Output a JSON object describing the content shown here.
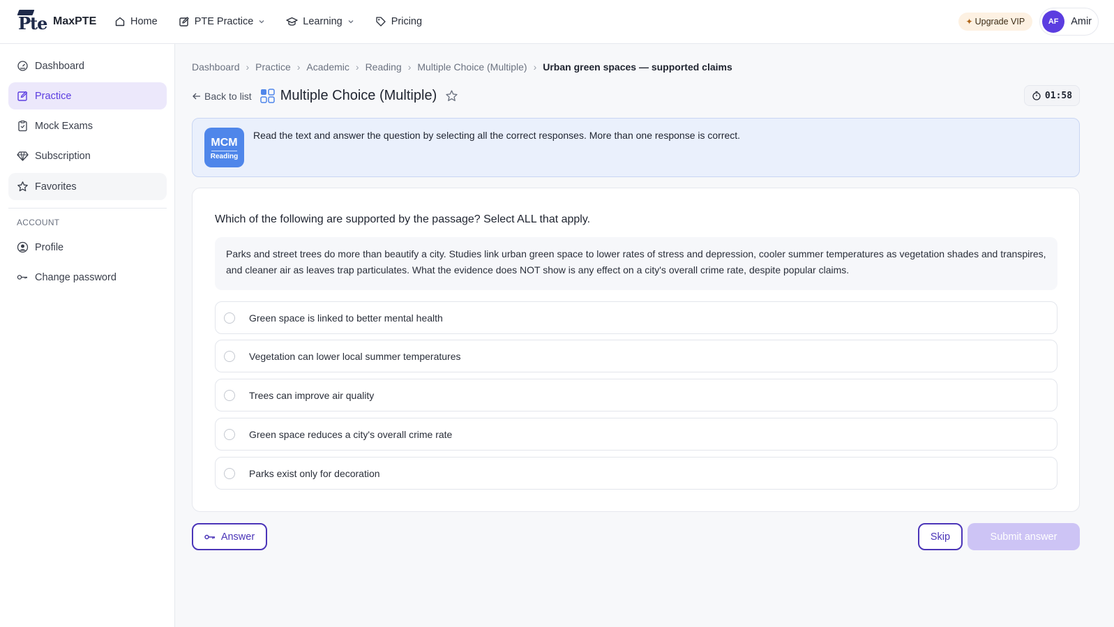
{
  "brand": {
    "logo_text": "Pte",
    "name": "MaxPTE"
  },
  "nav": {
    "home": "Home",
    "pte_practice": "PTE Practice",
    "learning": "Learning",
    "pricing": "Pricing"
  },
  "topbar": {
    "vip_label": "Upgrade VIP",
    "user_initials": "AF",
    "user_name": "Amir"
  },
  "sidebar": {
    "items": [
      {
        "label": "Dashboard",
        "icon": "dashboard-gauge-icon"
      },
      {
        "label": "Practice",
        "icon": "edit-square-icon",
        "active": true
      },
      {
        "label": "Mock Exams",
        "icon": "clipboard-icon"
      },
      {
        "label": "Subscription",
        "icon": "diamond-icon"
      },
      {
        "label": "Favorites",
        "icon": "star-icon"
      }
    ],
    "section_label": "ACCOUNT",
    "account_items": [
      {
        "label": "Profile",
        "icon": "user-circle-icon"
      },
      {
        "label": "Change password",
        "icon": "key-icon"
      }
    ]
  },
  "breadcrumb": [
    "Dashboard",
    "Practice",
    "Academic",
    "Reading",
    "Multiple Choice (Multiple)",
    "Urban green spaces — supported claims"
  ],
  "header": {
    "back_label": "Back to list",
    "title": "Multiple Choice (Multiple)",
    "timer": "01:58"
  },
  "instruction": {
    "badge_top": "MCM",
    "badge_bottom": "Reading",
    "text": "Read the text and answer the question by selecting all the correct responses. More than one response is correct."
  },
  "question": {
    "prompt": "Which of the following are supported by the passage? Select ALL that apply.",
    "passage": "Parks and street trees do more than beautify a city. Studies link urban green space to lower rates of stress and depression, cooler summer temperatures as vegetation shades and transpires, and cleaner air as leaves trap particulates. What the evidence does NOT show is any effect on a city's overall crime rate, despite popular claims.",
    "options": [
      "Green space is linked to better mental health",
      "Vegetation can lower local summer temperatures",
      "Trees can improve air quality",
      "Green space reduces a city's overall crime rate",
      "Parks exist only for decoration"
    ]
  },
  "actions": {
    "answer": "Answer",
    "skip": "Skip",
    "submit": "Submit answer"
  },
  "colors": {
    "accent": "#5b3de0",
    "button_border": "#4b35b8",
    "submit_disabled": "#cdc4f5",
    "instruction_bg": "#eaf0fc",
    "badge_bg": "#4f86ea"
  }
}
